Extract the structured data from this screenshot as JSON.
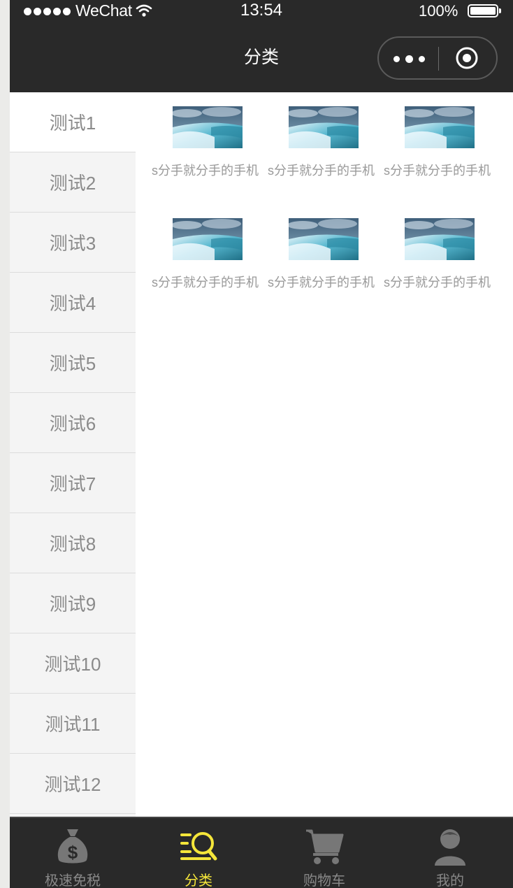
{
  "status_bar": {
    "carrier": "WeChat",
    "time": "13:54",
    "battery": "100%"
  },
  "nav": {
    "title": "分类",
    "more_icon": "more-dots-icon",
    "close_icon": "target-close-icon"
  },
  "categories": [
    {
      "label": "测试1",
      "active": true
    },
    {
      "label": "测试2"
    },
    {
      "label": "测试3"
    },
    {
      "label": "测试4"
    },
    {
      "label": "测试5"
    },
    {
      "label": "测试6"
    },
    {
      "label": "测试7"
    },
    {
      "label": "测试8"
    },
    {
      "label": "测试9"
    },
    {
      "label": "测试10"
    },
    {
      "label": "测试11"
    },
    {
      "label": "测试12"
    }
  ],
  "products": [
    {
      "name": "s分手就分手的手机",
      "image": "waterfall-thumbnail"
    },
    {
      "name": "s分手就分手的手机",
      "image": "waterfall-thumbnail"
    },
    {
      "name": "s分手就分手的手机",
      "image": "waterfall-thumbnail"
    },
    {
      "name": "s分手就分手的手机",
      "image": "waterfall-thumbnail"
    },
    {
      "name": "s分手就分手的手机",
      "image": "waterfall-thumbnail"
    },
    {
      "name": "s分手就分手的手机",
      "image": "waterfall-thumbnail"
    }
  ],
  "tabbar": {
    "tabs": [
      {
        "label": "极速免税",
        "icon": "money-bag-icon"
      },
      {
        "label": "分类",
        "icon": "category-search-icon",
        "active": true
      },
      {
        "label": "购物车",
        "icon": "cart-icon"
      },
      {
        "label": "我的",
        "icon": "user-icon"
      }
    ]
  },
  "colors": {
    "bar_bg": "#292929",
    "active_tab": "#f5e63a",
    "inactive_text": "#888888",
    "sidebar_bg": "#f4f4f4"
  }
}
